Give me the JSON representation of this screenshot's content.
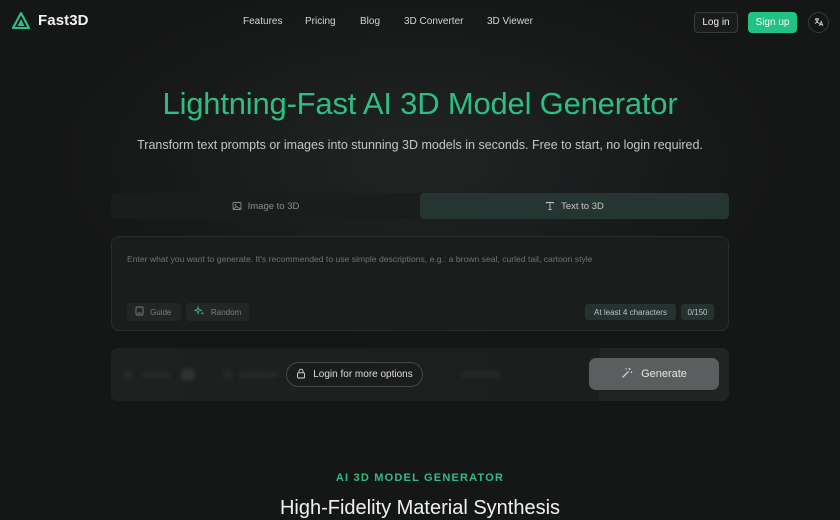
{
  "brand": {
    "name": "Fast3D",
    "accent": "#21c283"
  },
  "nav": {
    "items": [
      {
        "label": "Features"
      },
      {
        "label": "Pricing"
      },
      {
        "label": "Blog"
      },
      {
        "label": "3D Converter"
      },
      {
        "label": "3D Viewer"
      }
    ]
  },
  "auth": {
    "login_label": "Log in",
    "signup_label": "Sign up",
    "lang_icon": "translate-icon"
  },
  "hero": {
    "title": "Lightning-Fast AI 3D Model Generator",
    "subtitle": "Transform text prompts or images into stunning 3D models in seconds. Free to start, no login required."
  },
  "tabs": [
    {
      "label": "Image to 3D",
      "icon": "image-icon",
      "active": false
    },
    {
      "label": "Text to 3D",
      "icon": "text-icon",
      "active": true
    }
  ],
  "prompt": {
    "value": "",
    "placeholder": "Enter what you want to generate. It's recommended to use simple descriptions, e.g.: a brown seal, curled tail, cartoon style",
    "guide_label": "Guide",
    "random_label": "Random",
    "min_chars_label": "At least 4 characters",
    "char_count": "0/150"
  },
  "options": {
    "login_more_label": "Login for more options",
    "generate_label": "Generate"
  },
  "section": {
    "eyebrow": "AI 3D MODEL GENERATOR",
    "title": "High-Fidelity Material Synthesis"
  }
}
